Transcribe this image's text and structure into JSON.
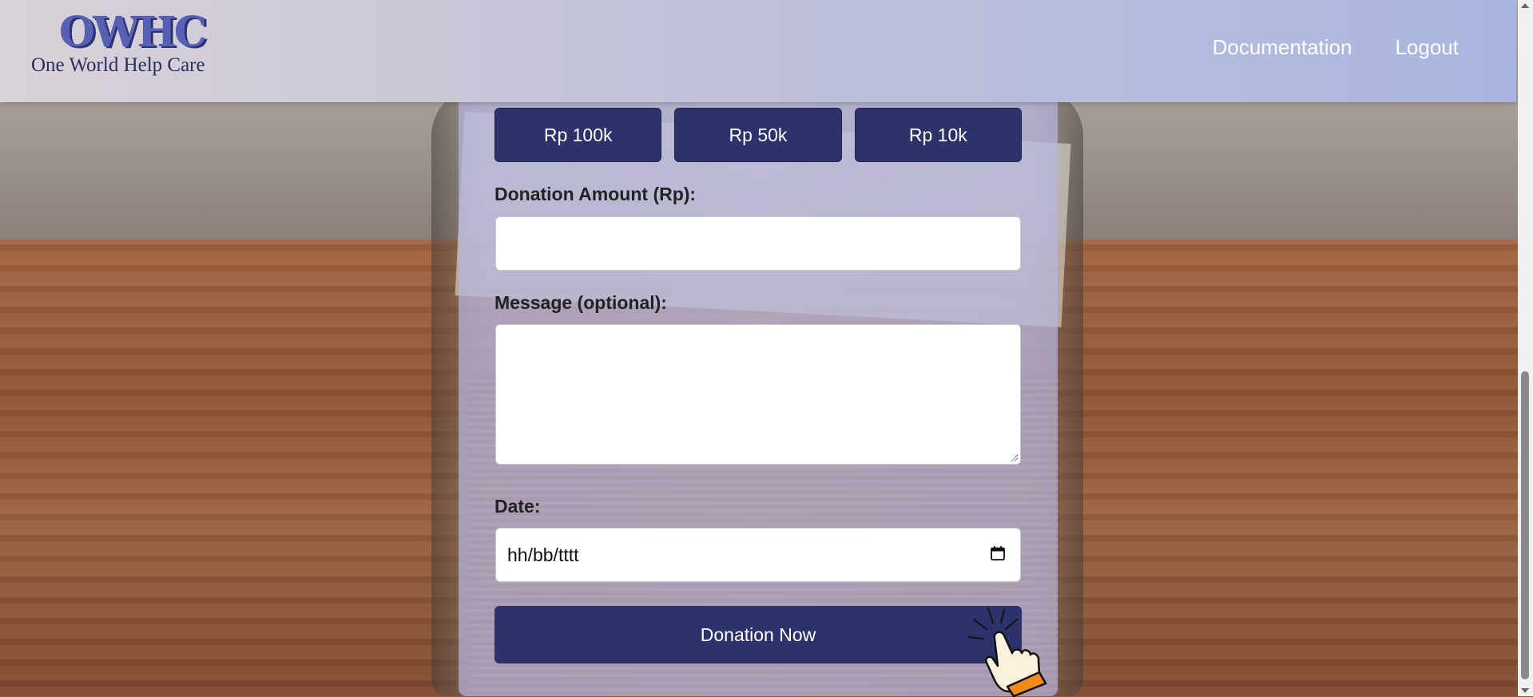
{
  "header": {
    "logo_mark": "OWHC",
    "logo_text": "One World Help Care",
    "nav": [
      {
        "label": "Documentation"
      },
      {
        "label": "Logout"
      }
    ]
  },
  "form": {
    "quick_amounts": [
      {
        "label": "Rp 100k"
      },
      {
        "label": "Rp 50k"
      },
      {
        "label": "Rp 10k"
      }
    ],
    "amount_label": "Donation Amount (Rp):",
    "amount_value": "",
    "message_label": "Message (optional):",
    "message_value": "",
    "date_label": "Date:",
    "date_placeholder": "hh/bb/tttt",
    "submit_label": "Donation Now"
  },
  "colors": {
    "primary": "#2d326a",
    "header_start": "#d9d2d9",
    "header_end": "#aab6e0",
    "card": "#b5b5de"
  },
  "icons": {
    "calendar": "calendar-icon",
    "pointer": "hand-pointer-icon"
  }
}
